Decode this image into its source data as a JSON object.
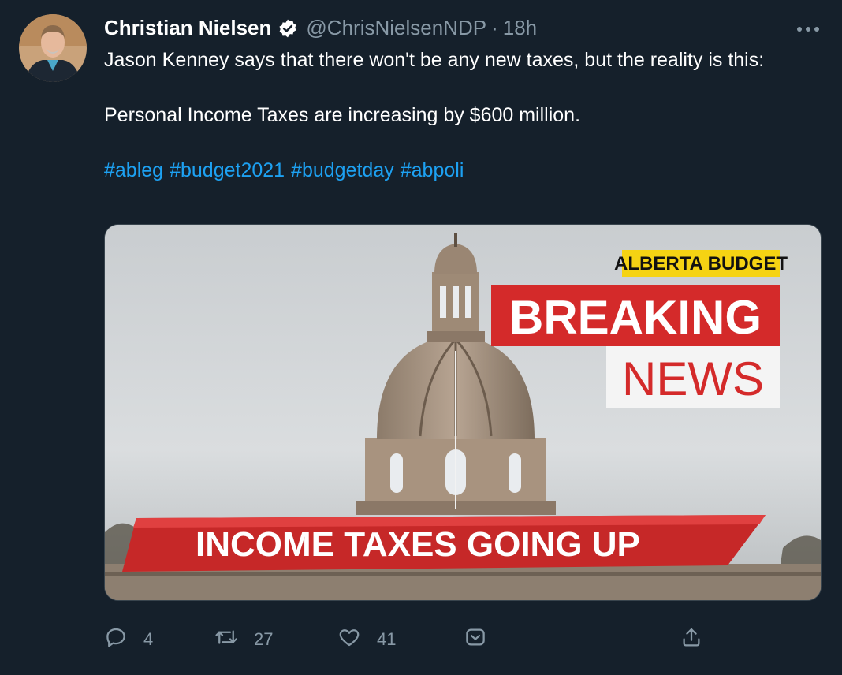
{
  "author": {
    "name": "Christian Nielsen",
    "handle": "@ChrisNielsenNDP",
    "separator": "·",
    "time": "18h"
  },
  "tweet": {
    "line1": "Jason Kenney says that there won't be any new taxes, but the reality is this:",
    "line2": "Personal Income Taxes are increasing by $600 million.",
    "hashtags": [
      "#ableg",
      "#budget2021",
      "#budgetday",
      "#abpoli"
    ]
  },
  "media": {
    "tag": "ALBERTA BUDGET",
    "breaking": "BREAKING",
    "news": "NEWS",
    "banner": "INCOME TAXES GOING UP"
  },
  "actions": {
    "replies": "4",
    "retweets": "27",
    "likes": "41"
  },
  "colors": {
    "background": "#15202b",
    "link": "#1da1f2",
    "muted": "#8899a6",
    "breaking_red": "#d42a2a",
    "tag_yellow": "#f5d313"
  },
  "icons": [
    "more-icon",
    "verified-icon",
    "reply-icon",
    "retweet-icon",
    "like-icon",
    "bookmark-icon",
    "share-icon"
  ]
}
